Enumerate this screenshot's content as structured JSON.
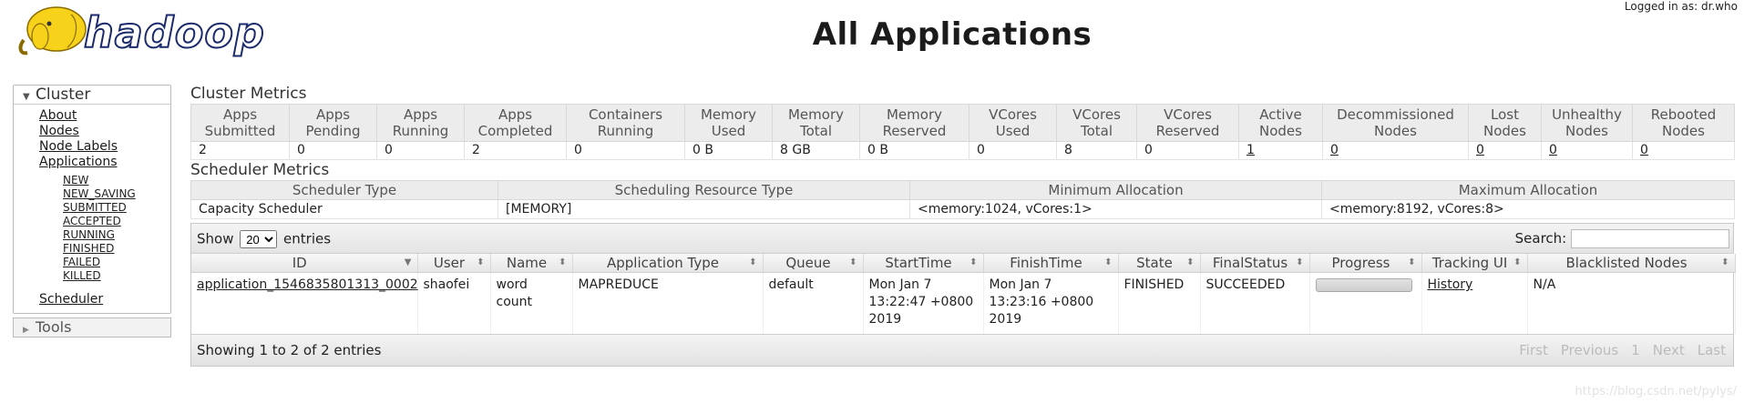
{
  "header": {
    "logo_text": "hadoop",
    "title": "All Applications",
    "logged_in": "Logged in as: dr.who"
  },
  "sidebar": {
    "cluster_label": "Cluster",
    "links": [
      "About",
      "Nodes",
      "Node Labels",
      "Applications"
    ],
    "states": [
      "NEW",
      "NEW_SAVING",
      "SUBMITTED",
      "ACCEPTED",
      "RUNNING",
      "FINISHED",
      "FAILED",
      "KILLED"
    ],
    "scheduler": "Scheduler",
    "tools_label": "Tools"
  },
  "cluster_metrics": {
    "title": "Cluster Metrics",
    "headers": [
      [
        "Apps",
        "Submitted"
      ],
      [
        "Apps",
        "Pending"
      ],
      [
        "Apps",
        "Running"
      ],
      [
        "Apps",
        "Completed"
      ],
      [
        "Containers",
        "Running"
      ],
      [
        "Memory",
        "Used"
      ],
      [
        "Memory",
        "Total"
      ],
      [
        "Memory",
        "Reserved"
      ],
      [
        "VCores",
        "Used"
      ],
      [
        "VCores",
        "Total"
      ],
      [
        "VCores",
        "Reserved"
      ],
      [
        "Active",
        "Nodes"
      ],
      [
        "Decommissioned",
        "Nodes"
      ],
      [
        "Lost",
        "Nodes"
      ],
      [
        "Unhealthy",
        "Nodes"
      ],
      [
        "Rebooted",
        "Nodes"
      ]
    ],
    "values": [
      "2",
      "0",
      "0",
      "2",
      "0",
      "0 B",
      "8 GB",
      "0 B",
      "0",
      "8",
      "0",
      "1",
      "0",
      "0",
      "0",
      "0"
    ]
  },
  "scheduler_metrics": {
    "title": "Scheduler Metrics",
    "headers": [
      "Scheduler Type",
      "Scheduling Resource Type",
      "Minimum Allocation",
      "Maximum Allocation"
    ],
    "values": [
      "Capacity Scheduler",
      "[MEMORY]",
      "<memory:1024, vCores:1>",
      "<memory:8192, vCores:8>"
    ]
  },
  "apps_table": {
    "show_label": "Show",
    "page_size": "20",
    "entries_label": "entries",
    "search_label": "Search:",
    "search_value": "",
    "columns": [
      "ID",
      "User",
      "Name",
      "Application Type",
      "Queue",
      "StartTime",
      "FinishTime",
      "State",
      "FinalStatus",
      "Progress",
      "Tracking UI",
      "Blacklisted Nodes"
    ],
    "rows": [
      {
        "id": "application_1546835801313_0002",
        "user": "shaofei",
        "name": "word count",
        "type": "MAPREDUCE",
        "queue": "default",
        "start": "Mon Jan 7 13:22:47 +0800 2019",
        "finish": "Mon Jan 7 13:23:16 +0800 2019",
        "state": "FINISHED",
        "final_status": "SUCCEEDED",
        "progress": 100,
        "tracking_ui": "History",
        "blacklisted": "N/A"
      }
    ],
    "footer_info": "Showing 1 to 2 of 2 entries",
    "pager": [
      "First",
      "Previous",
      "1",
      "Next",
      "Last"
    ]
  },
  "watermark": "https://blog.csdn.net/pylys/"
}
